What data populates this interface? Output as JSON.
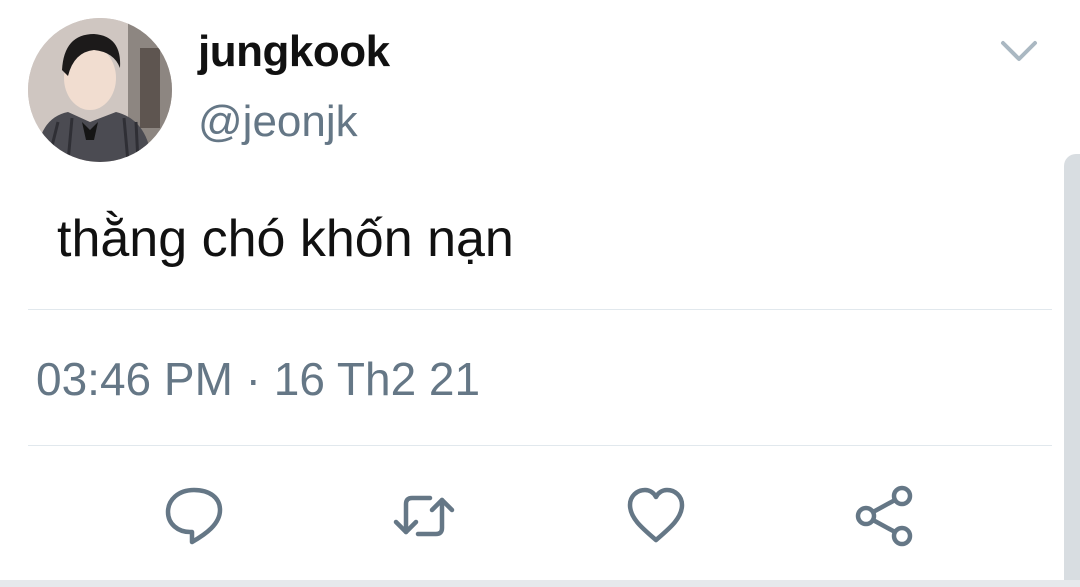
{
  "tweet": {
    "display_name": "jungkook",
    "handle": "@jeonjk",
    "text": "thằng chó khốn nạn",
    "timestamp": "03:46 PM · 16 Th2 21"
  },
  "icons": {
    "menu": "chevron-down-icon",
    "reply": "reply-icon",
    "retweet": "retweet-icon",
    "like": "heart-icon",
    "share": "share-icon"
  },
  "colors": {
    "text": "#111111",
    "secondary": "#657786",
    "divider": "#e1e8ed",
    "icon": "#657786",
    "caret": "#aab8c2"
  }
}
